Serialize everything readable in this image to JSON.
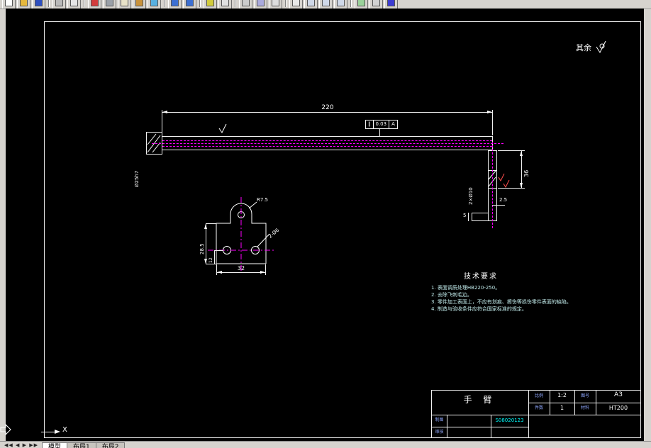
{
  "toolbar": {
    "icons": [
      "new-icon",
      "open-icon",
      "save-icon",
      "print-icon",
      "preview-icon",
      "spelling-icon",
      "cut-icon",
      "copy-icon",
      "paste-icon",
      "match-props-icon",
      "undo-icon",
      "redo-icon",
      "insert-icon",
      "osnap-icon",
      "ucs-icon",
      "distance-icon",
      "redraw-icon",
      "pan-icon",
      "zoom-realtime-icon",
      "zoom-window-icon",
      "zoom-previous-icon",
      "properties-icon",
      "aerial-view-icon",
      "help-icon"
    ]
  },
  "drawing": {
    "surplus_label": "其余",
    "side_view": {
      "dim_length": "220",
      "dim_height": "36",
      "dim_thickness": "2.5",
      "dim_foot": "5",
      "label_holes": "2×Ø10",
      "label_shaft": "Ø25h7",
      "tolerance": {
        "symbol": "∥",
        "value": "0.03",
        "datum": "A"
      }
    },
    "front_view": {
      "dim_radius": "R7.5",
      "dim_height": "28.5",
      "dim_hole_offset": "12",
      "dim_width": "32",
      "label_holes": "2-Ø6"
    },
    "tech_req": {
      "title": "技术要求",
      "items": [
        "1. 表面调质处理HB220-250。",
        "2. 去除飞刺毛边。",
        "3. 零件加工表面上，不应有划痕、擦伤等损伤零件表面的缺陷。",
        "4. 制造与验收条件应符合国家标准的规定。"
      ]
    },
    "title_block": {
      "part_name": "手 臂",
      "scale_label": "比例",
      "scale": "1:2",
      "sheet_label": "图号",
      "sheet": "A3",
      "qty_label": "件数",
      "qty": "1",
      "material_label": "材料",
      "material": "HT200",
      "drafter_label": "制图",
      "checker_label": "审核",
      "drawing_no": "S08020123"
    },
    "ucs_x_label": "X"
  },
  "statusbar": {
    "nav": "◀◀ ◀ ▶ ▶▶",
    "tabs": [
      "模型",
      "布局1",
      "布局2"
    ]
  }
}
